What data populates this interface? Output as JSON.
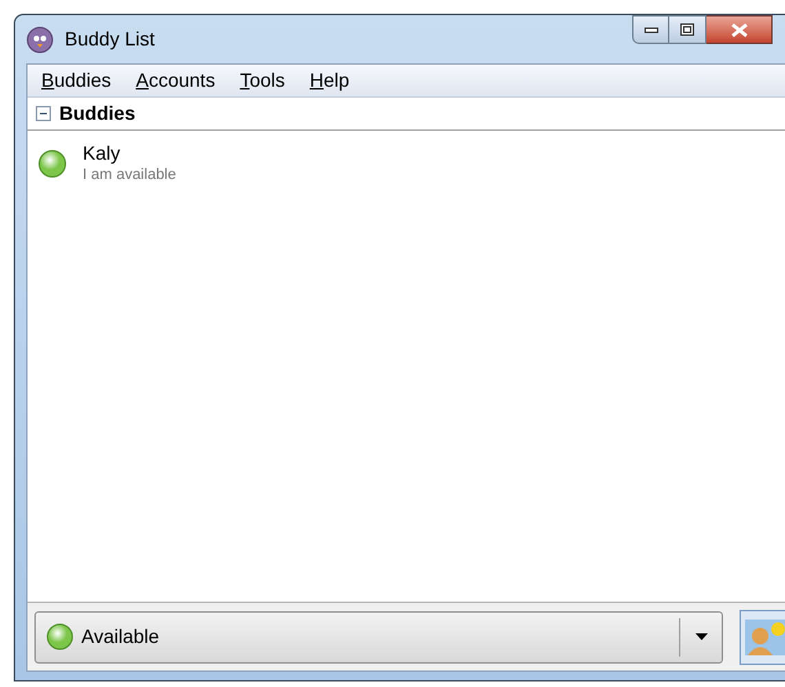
{
  "window": {
    "title": "Buddy List"
  },
  "menu": [
    {
      "label": "Buddies"
    },
    {
      "label": "Accounts"
    },
    {
      "label": "Tools"
    },
    {
      "label": "Help"
    }
  ],
  "groups": [
    {
      "name": "Buddies",
      "expanded": true,
      "buddies": [
        {
          "name": "Kaly",
          "status_message": "I am available",
          "color": "#7cc64a"
        }
      ]
    }
  ],
  "status_selector": {
    "value": "Available",
    "color": "#7cc64a"
  }
}
